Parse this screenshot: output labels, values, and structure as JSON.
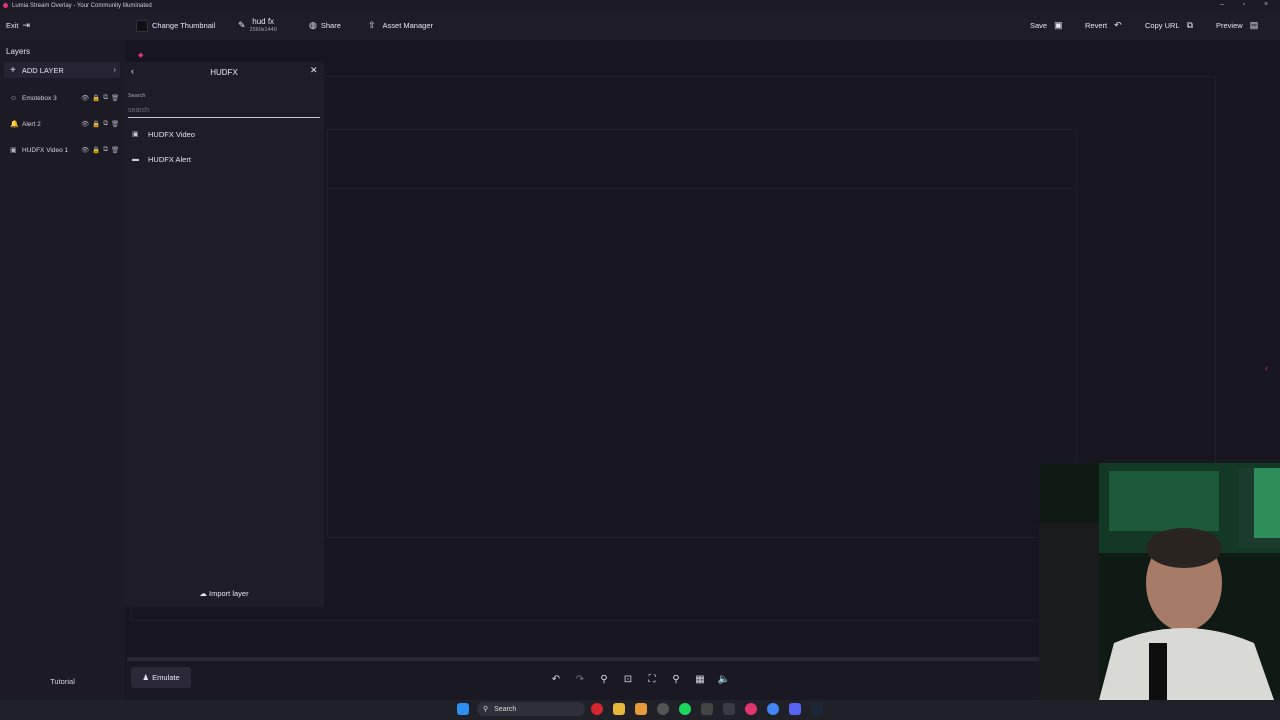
{
  "window": {
    "title": "Lumia Stream Overlay - Your Community Illuminated",
    "controls": [
      "–",
      "▫",
      "×"
    ]
  },
  "toolbar": {
    "exit_label": "Exit",
    "change_thumbnail_label": "Change Thumbnail",
    "overlay_name": "hud fx",
    "overlay_resolution": "2560x1440",
    "share_label": "Share",
    "asset_manager_label": "Asset Manager",
    "save_label": "Save",
    "revert_label": "Revert",
    "copy_url_label": "Copy URL",
    "preview_label": "Preview"
  },
  "layers_panel": {
    "header": "Layers",
    "add_layer_label": "ADD LAYER",
    "items": [
      {
        "name": "Emotebox 3",
        "icon": "emote-icon"
      },
      {
        "name": "Alert 2",
        "icon": "alert-icon"
      },
      {
        "name": "HUDFX Video 1",
        "icon": "video-icon"
      }
    ],
    "tutorial_label": "Tutorial"
  },
  "hudfx_panel": {
    "title": "HUDFX",
    "search_label": "Search",
    "search_placeholder": "search",
    "search_value": "",
    "items": [
      {
        "name": "HUDFX Video",
        "icon": "video-icon"
      },
      {
        "name": "HUDFX Alert",
        "icon": "chat-icon"
      }
    ],
    "import_label": "Import layer"
  },
  "bottom": {
    "emulate_label": "Emulate",
    "tools": [
      "undo-icon",
      "redo-icon",
      "zoom-out-icon",
      "fit-icon",
      "fullscreen-icon",
      "zoom-in-icon",
      "grid-icon",
      "volume-icon"
    ]
  },
  "taskbar": {
    "search_label": "Search"
  },
  "colors": {
    "accent": "#e0356e",
    "panel": "#1e1c28",
    "canvas": "#17151f"
  }
}
